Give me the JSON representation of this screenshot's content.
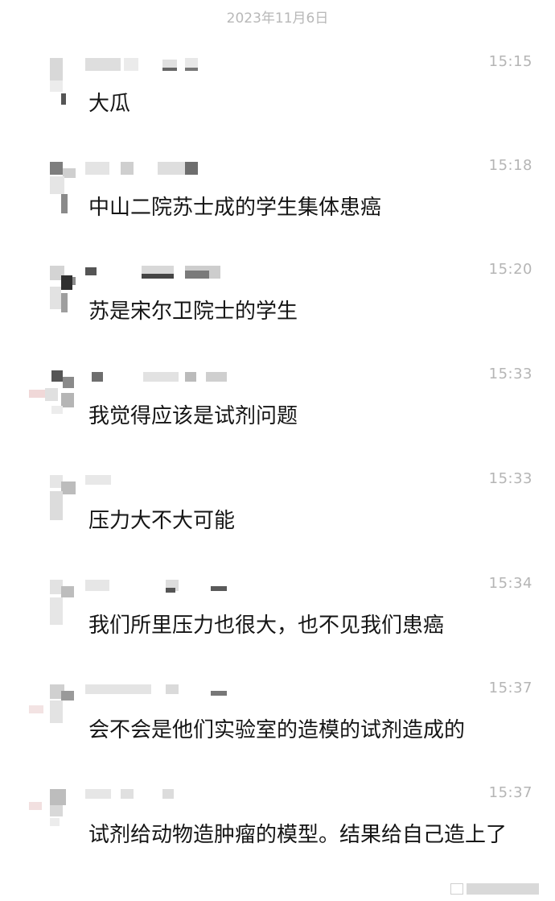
{
  "chat": {
    "date": "2023年11月6日",
    "messages": [
      {
        "time": "15:15",
        "text": "大瓜"
      },
      {
        "time": "15:18",
        "text": "中山二院苏士成的学生集体患癌"
      },
      {
        "time": "15:20",
        "text": "苏是宋尔卫院士的学生"
      },
      {
        "time": "15:33",
        "text": "我觉得应该是试剂问题"
      },
      {
        "time": "15:33",
        "text": "压力大不大可能"
      },
      {
        "time": "15:34",
        "text": "我们所里压力也很大，也不见我们患癌"
      },
      {
        "time": "15:37",
        "text": "会不会是他们实验室的造模的试剂造成的"
      },
      {
        "time": "15:37",
        "text": "试剂给动物造肿瘤的模型。结果给自己造上了"
      }
    ]
  },
  "colors": {
    "background": "#ffffff",
    "text": "#151515",
    "timestamp": "#b5b5b5",
    "date": "#b8b8b8",
    "pixelation": [
      "#e6e6e6",
      "#bcbcbc",
      "#7a7a7a",
      "#3a3a3a"
    ]
  }
}
